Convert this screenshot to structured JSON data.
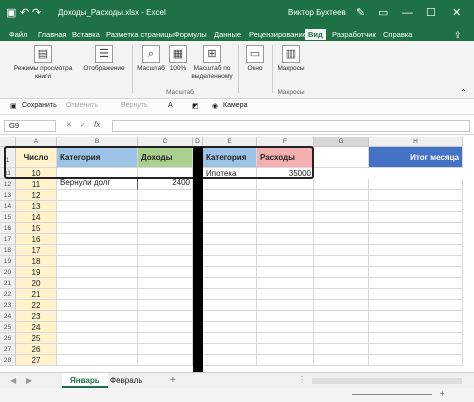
{
  "title": {
    "filename": "Доходы_Расходы.xlsx",
    "app": "Excel",
    "user": "Виктор Бухтеев"
  },
  "tabs": [
    "Файл",
    "Главная",
    "Вставка",
    "Разметка страницы",
    "Формулы",
    "Данные",
    "Рецензирование",
    "Вид",
    "Разработчик",
    "Справка"
  ],
  "active_tab": "Вид",
  "ribbon": {
    "views_btn": "Режимы просмотра книги",
    "show_btn": "Отображение",
    "zoom_btn": "Масштаб",
    "zoom100_btn": "100%",
    "zoomsel_btn": "Масштаб по выделенному",
    "window_btn": "Окно",
    "macros_btn": "Макросы",
    "group_zoom": "Масштаб",
    "group_macros": "Макросы"
  },
  "quick": {
    "save": "Сохранить",
    "undo": "Отменить",
    "redo": "Вернуть",
    "camera": "Камера"
  },
  "namebox": "G9",
  "fx": "fx",
  "columns": [
    "A",
    "B",
    "C",
    "D",
    "E",
    "F",
    "G",
    "H"
  ],
  "rows": [
    "1",
    "11",
    "12",
    "13",
    "14",
    "15",
    "16",
    "17",
    "18",
    "19",
    "20",
    "21",
    "22",
    "23",
    "24",
    "25",
    "26",
    "27",
    "28"
  ],
  "header_row": {
    "a": "Число",
    "b": "Категория",
    "c": "Доходы",
    "e": "Категория",
    "f": "Расходы",
    "h": "Итог месяца"
  },
  "row11": {
    "a": "10",
    "e": "Ипотека",
    "f": "35000"
  },
  "row12": {
    "b": "Вернули долг",
    "c": "2400"
  },
  "numbers": [
    "11",
    "12",
    "13",
    "14",
    "15",
    "16",
    "17",
    "18",
    "19",
    "20",
    "21",
    "22",
    "23",
    "24",
    "25",
    "26",
    "27"
  ],
  "sheets": [
    "Январь",
    "Февраль"
  ],
  "colors": {
    "excel_green": "#1e7145",
    "yellow": "#fff2cc",
    "blue": "#9dc3e6",
    "green": "#a9d08e",
    "red": "#f4b0b0",
    "darkblue": "#4472c4"
  }
}
